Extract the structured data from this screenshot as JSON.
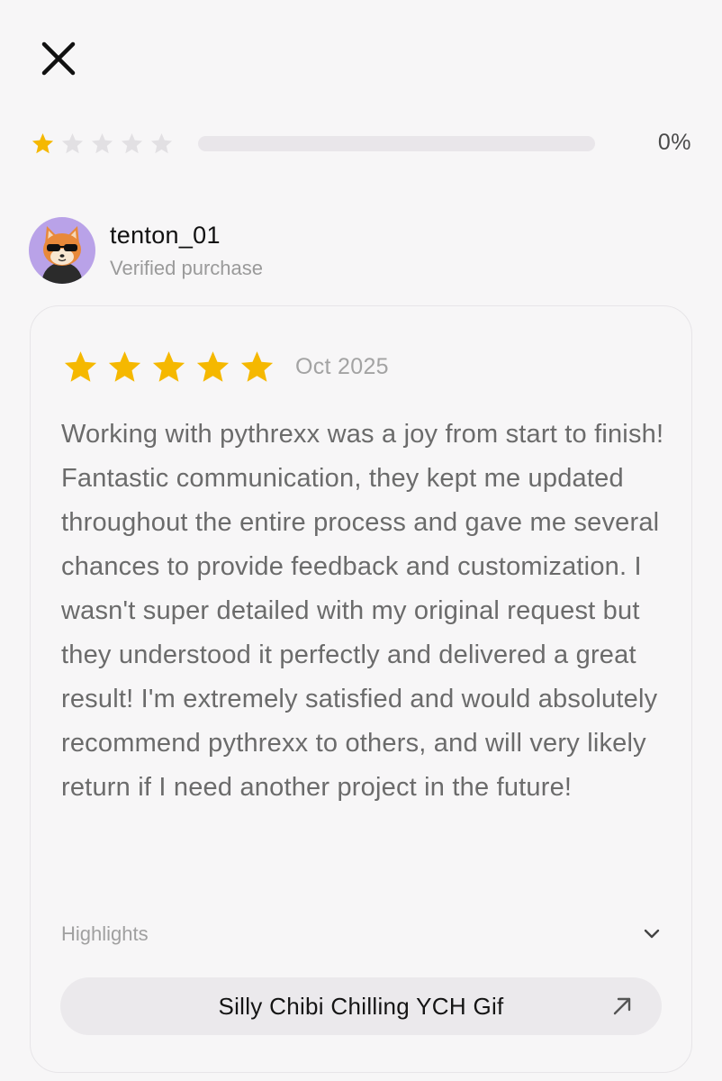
{
  "rating_summary": {
    "star_level": 1,
    "max_stars": 5,
    "bar_fill_fraction": 0.0,
    "percent_label": "0%",
    "star_color": "#f5b800",
    "empty_star_color": "#e2e0e3"
  },
  "review": {
    "username": "tenton_01",
    "verified_label": "Verified purchase",
    "rating": 5,
    "date": "Oct 2025",
    "text": "Working with pythrexx was a joy from start to finish! Fantastic communication, they kept me updated throughout the entire process and gave me several chances to provide feedback and customization. I wasn't super detailed with my original request but they understood it perfectly and delivered a great result! I'm extremely satisfied and would absolutely recommend pythrexx to others, and will very likely return if I need another project in the future!",
    "highlights_label": "Highlights",
    "product_link_label": "Silly Chibi Chilling YCH Gif"
  },
  "icons": {
    "close": "close-icon",
    "chevron": "chevron-down-icon",
    "arrow": "arrow-up-right-icon",
    "avatar": "avatar-shiba-sunglasses"
  },
  "colors": {
    "background": "#f7f6f7",
    "avatar_bg": "#b9a2e8",
    "pill_bg": "#ebe9ec"
  }
}
